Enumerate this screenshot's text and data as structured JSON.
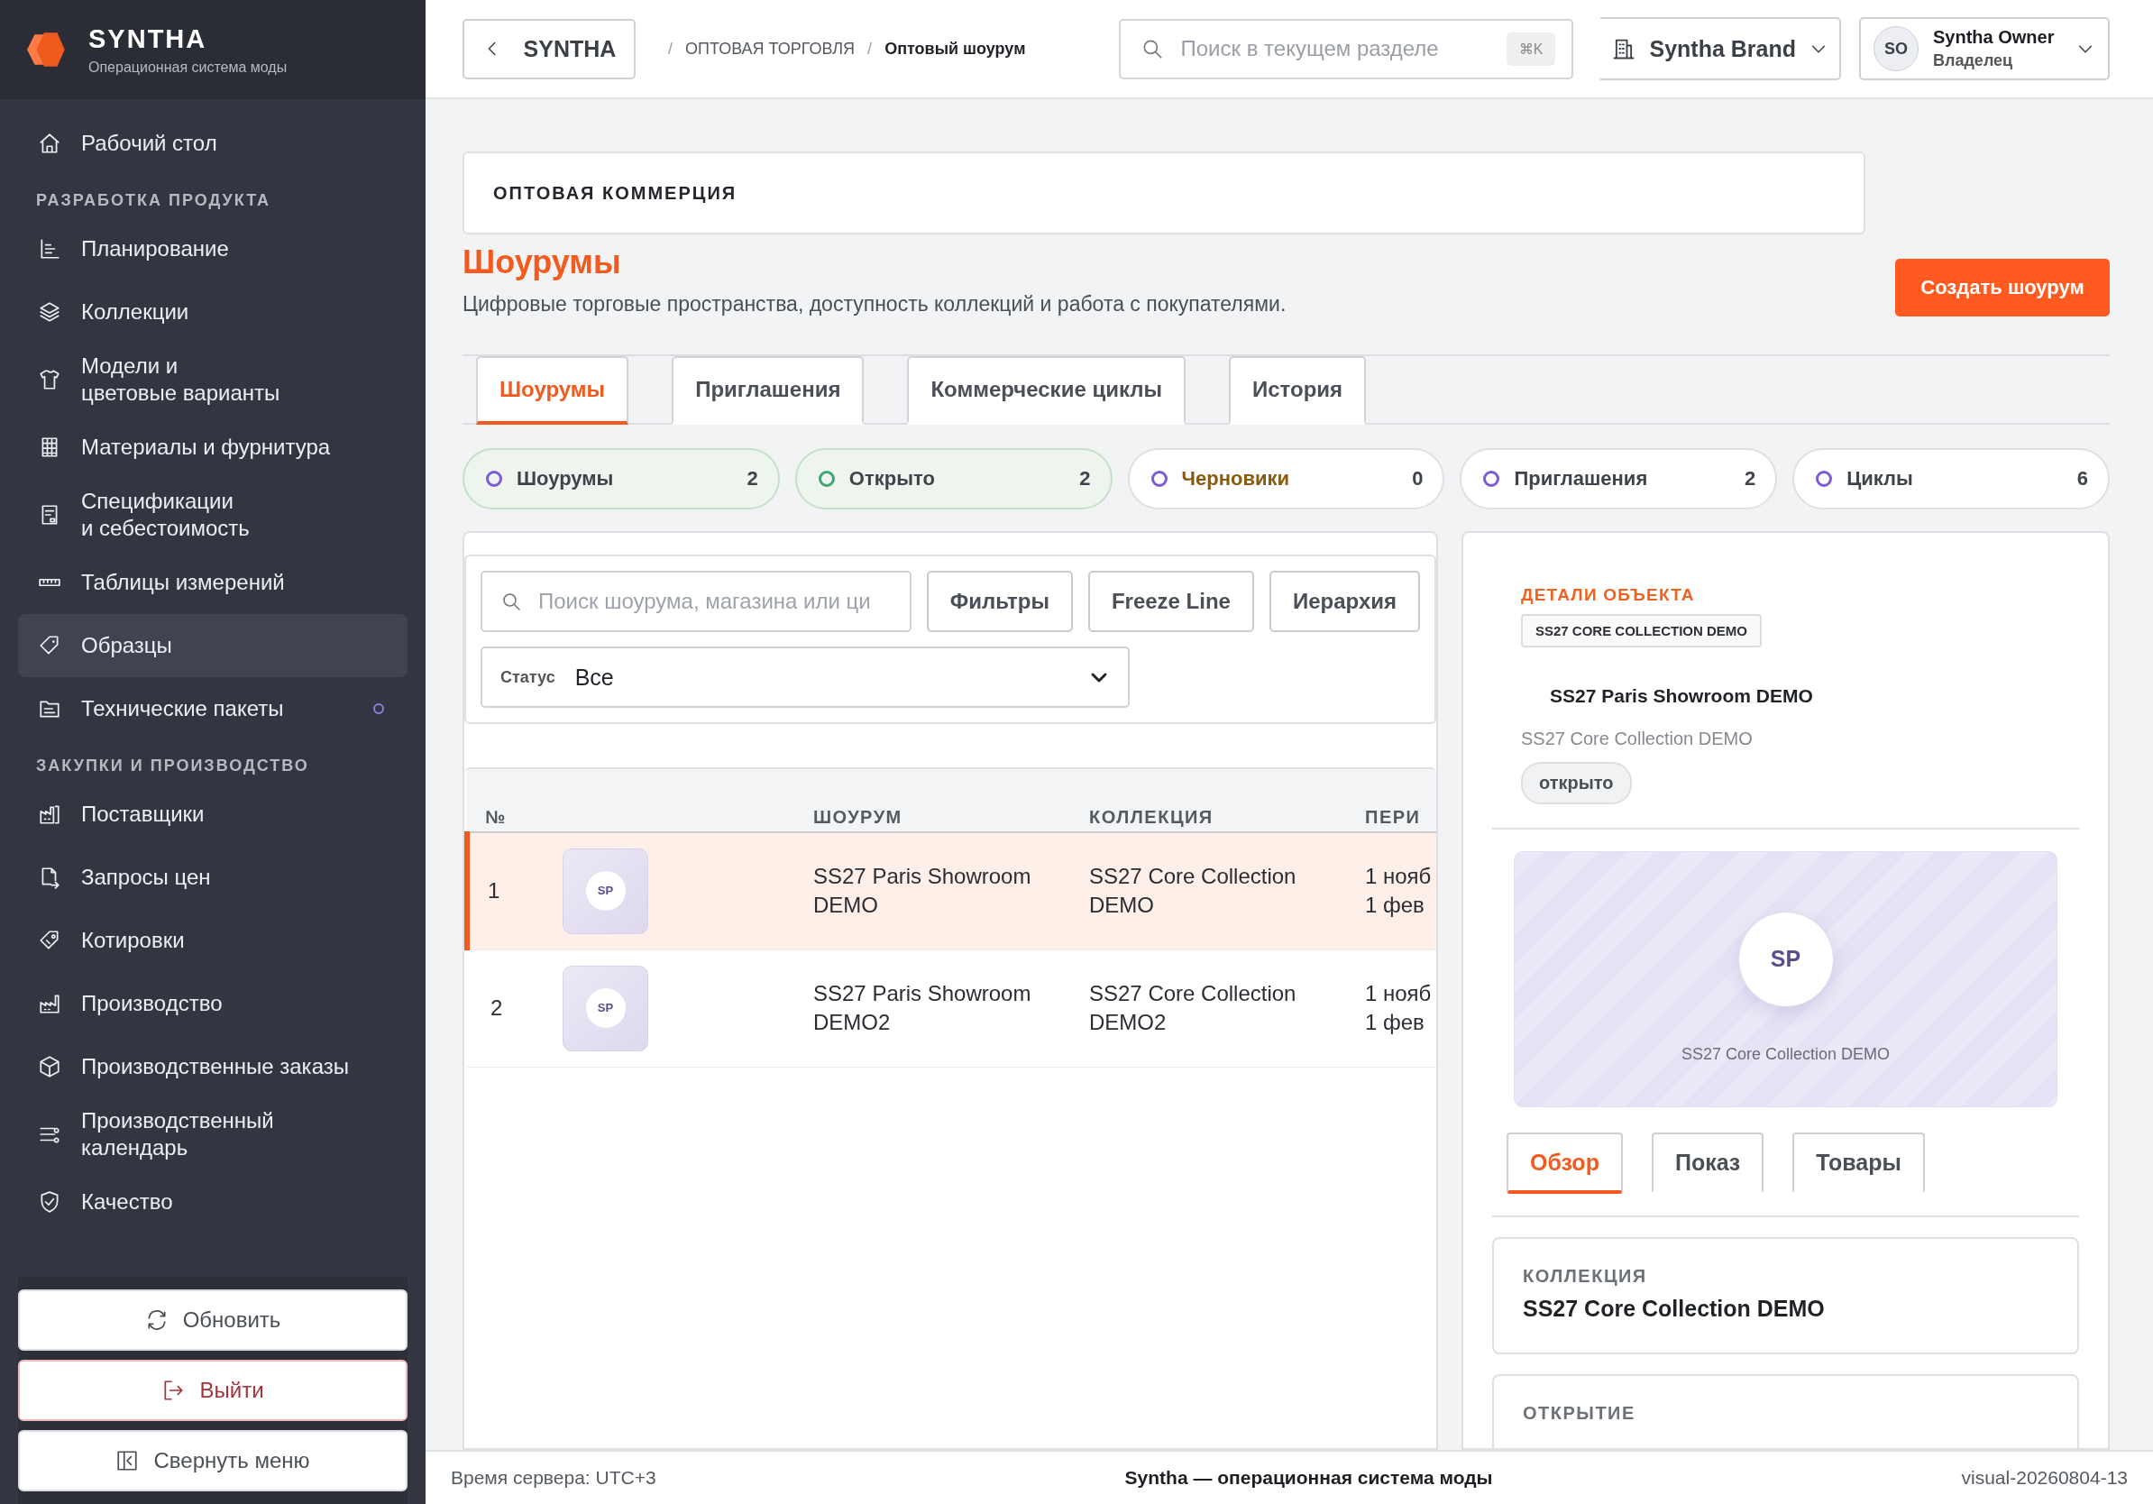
{
  "brand": {
    "name": "SYNTHA",
    "tagline": "Операционная система моды"
  },
  "sidebar": {
    "sections": [
      {
        "items": [
          {
            "label": "Рабочий стол",
            "selected": false,
            "dot": false
          }
        ]
      },
      {
        "heading": "РАЗРАБОТКА ПРОДУКТА",
        "items": [
          {
            "label": "Планирование",
            "selected": false,
            "dot": false
          },
          {
            "label": "Коллекции",
            "selected": false,
            "dot": false
          },
          {
            "label": "Модели и\nцветовые варианты",
            "selected": false,
            "dot": false
          },
          {
            "label": "Материалы и фурнитура",
            "selected": false,
            "dot": false
          },
          {
            "label": "Спецификации\nи себестоимость",
            "selected": false,
            "dot": false
          },
          {
            "label": "Таблицы измерений",
            "selected": false,
            "dot": false
          },
          {
            "label": "Образцы",
            "selected": true,
            "dot": false
          },
          {
            "label": "Технические пакеты",
            "selected": false,
            "dot": true
          }
        ]
      },
      {
        "heading": "ЗАКУПКИ И ПРОИЗВОДСТВО",
        "items": [
          {
            "label": "Поставщики",
            "selected": false,
            "dot": false
          },
          {
            "label": "Запросы цен",
            "selected": false,
            "dot": false
          },
          {
            "label": "Котировки",
            "selected": false,
            "dot": false
          },
          {
            "label": "Производство",
            "selected": false,
            "dot": false
          },
          {
            "label": "Производственные заказы",
            "selected": false,
            "dot": false
          },
          {
            "label": "Производственный\nкалендарь",
            "selected": false,
            "dot": false
          },
          {
            "label": "Качество",
            "selected": false,
            "dot": false
          }
        ]
      }
    ],
    "actions": [
      {
        "label": "Обновить",
        "kind": "refresh"
      },
      {
        "label": "Выйти",
        "kind": "logout"
      },
      {
        "label": "Свернуть меню",
        "kind": "collapse"
      }
    ]
  },
  "header": {
    "back": "SYNTHA",
    "breadcrumb": [
      "ОПТОВАЯ ТОРГОВЛЯ",
      "Оптовый шоурум"
    ],
    "separator": "/",
    "search": {
      "placeholder": "Поиск в текущем разделе",
      "shortcut": "⌘K"
    },
    "workspace": "Syntha Brand",
    "user": {
      "initials": "SO",
      "name": "Syntha Owner",
      "role": "Владелец"
    }
  },
  "section": "ОПТОВАЯ КОММЕРЦИЯ",
  "page": {
    "title": "Шоурумы",
    "subtitle": "Цифровые торговые пространства, доступность коллекций и работа с покупателями.",
    "create": "Создать шоурум"
  },
  "tabs": [
    {
      "label": "Шоурумы",
      "selected": true
    },
    {
      "label": "Приглашения",
      "selected": false
    },
    {
      "label": "Коммерческие циклы",
      "selected": false
    },
    {
      "label": "История",
      "selected": false
    }
  ],
  "stats": [
    {
      "label": "Шоурумы",
      "count": "2",
      "kind": "success",
      "color": "#7b5cd6"
    },
    {
      "label": "Открыто",
      "count": "2",
      "kind": "success",
      "color": "#3fa672"
    },
    {
      "label": "Черновики",
      "count": "0",
      "kind": "warning",
      "color": "#7b5cd6"
    },
    {
      "label": "Приглашения",
      "count": "2",
      "kind": "neutral",
      "color": "#7b5cd6"
    },
    {
      "label": "Циклы",
      "count": "6",
      "kind": "neutral",
      "color": "#7b5cd6"
    }
  ],
  "toolbar": {
    "search": {
      "placeholder": "Поиск шоурума, магазина или ци"
    },
    "buttons": [
      "Фильтры",
      "Freeze Line",
      "Иерархия"
    ],
    "status": {
      "label": "Статус",
      "value": "Все"
    }
  },
  "table": {
    "columns": [
      "№",
      "ШОУРУМ",
      "КОЛЛЕКЦИЯ",
      "ПЕРИ"
    ],
    "rows": [
      {
        "number": "1",
        "initials": "SP",
        "showroom": "SS27 Paris Showroom\nDEMO",
        "collection": "SS27 Core Collection\nDEMO",
        "period": "1 нояб\n1 фев",
        "selected": true
      },
      {
        "number": "2",
        "initials": "SP",
        "showroom": "SS27 Paris Showroom\nDEMO2",
        "collection": "SS27 Core Collection\nDEMO2",
        "period": "1 нояб\n1 фев",
        "selected": false
      }
    ]
  },
  "details": {
    "eyebrow": "ДЕТАЛИ ОБЪЕКТА",
    "tag": "SS27 CORE COLLECTION DEMO",
    "title": "SS27 Paris Showroom DEMO",
    "subtitle": "SS27 Core Collection DEMO",
    "status": "открыто",
    "preview": {
      "initials": "SP",
      "caption": "SS27 Core Collection DEMO"
    },
    "tabs": [
      {
        "label": "Обзор",
        "selected": true
      },
      {
        "label": "Показ",
        "selected": false
      },
      {
        "label": "Товары",
        "selected": false
      }
    ],
    "fields": [
      {
        "label": "КОЛЛЕКЦИЯ",
        "value": "SS27 Core Collection DEMO"
      },
      {
        "label": "ОТКРЫТИЕ"
      }
    ]
  },
  "status_bar": {
    "left": "Время сервера: UTC+3",
    "center": "Syntha — операционная система моды",
    "right": "visual-20260804-13"
  }
}
